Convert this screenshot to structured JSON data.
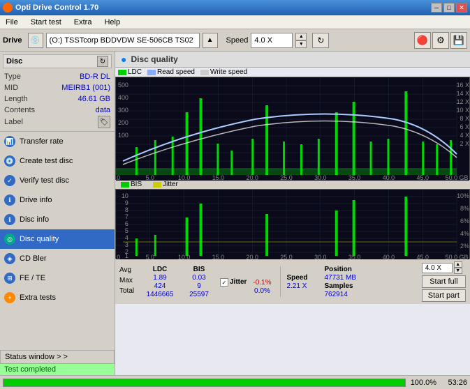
{
  "app": {
    "title": "Opti Drive Control 1.70",
    "icon": "disc-icon"
  },
  "titlebar": {
    "minimize": "─",
    "maximize": "□",
    "close": "✕"
  },
  "menu": {
    "items": [
      "File",
      "Start test",
      "Extra",
      "Help"
    ]
  },
  "drivebar": {
    "drive_label": "Drive",
    "drive_value": "(O:)  TSSTcorp BDDVDW SE-506CB TS02",
    "speed_label": "Speed",
    "speed_value": "4.0 X"
  },
  "disc": {
    "title": "Disc",
    "type_label": "Type",
    "type_value": "BD-R DL",
    "mid_label": "MID",
    "mid_value": "MEIRB1 (001)",
    "length_label": "Length",
    "length_value": "46.61 GB",
    "contents_label": "Contents",
    "contents_value": "data",
    "label_label": "Label"
  },
  "sidebar": {
    "items": [
      {
        "label": "Transfer rate",
        "icon": "chart-icon"
      },
      {
        "label": "Create test disc",
        "icon": "disc-create-icon"
      },
      {
        "label": "Verify test disc",
        "icon": "disc-verify-icon"
      },
      {
        "label": "Drive info",
        "icon": "drive-info-icon"
      },
      {
        "label": "Disc info",
        "icon": "disc-info-icon"
      },
      {
        "label": "Disc quality",
        "icon": "disc-quality-icon",
        "active": true
      },
      {
        "label": "CD Bler",
        "icon": "cd-bler-icon"
      },
      {
        "label": "FE / TE",
        "icon": "fe-te-icon"
      },
      {
        "label": "Extra tests",
        "icon": "extra-tests-icon"
      }
    ],
    "status_window": "Status window > >",
    "test_completed": "Test completed"
  },
  "disc_quality": {
    "title": "Disc quality",
    "legend": {
      "ldc_label": "LDC",
      "ldc_color": "#00cc00",
      "read_speed_label": "Read speed",
      "read_speed_color": "#aaccff",
      "write_speed_label": "Write speed",
      "write_speed_color": "#ffffff",
      "bis_label": "BIS",
      "bis_color": "#00cc00",
      "jitter_label": "Jitter",
      "jitter_color": "#ffff00"
    }
  },
  "stats": {
    "ldc_header": "LDC",
    "bis_header": "BIS",
    "jitter_header": "Jitter",
    "speed_header": "Speed",
    "position_header": "Position",
    "samples_header": "Samples",
    "avg_label": "Avg",
    "max_label": "Max",
    "total_label": "Total",
    "ldc_avg": "1.89",
    "ldc_max": "424",
    "ldc_total": "1446665",
    "bis_avg": "0.03",
    "bis_max": "9",
    "bis_total": "25597",
    "jitter_avg": "-0.1%",
    "jitter_max": "0.0%",
    "speed_val": "2.21 X",
    "position_val": "47731 MB",
    "samples_val": "762914",
    "speed_select": "4.0 X",
    "start_full": "Start full",
    "start_part": "Start part"
  },
  "statusbar": {
    "progress_pct": 100,
    "progress_text": "100.0%",
    "time": "53:26"
  },
  "colors": {
    "bg_dark": "#1a1a2e",
    "grid_line": "#2a2a4a",
    "ldc_bar": "#00cc00",
    "read_speed": "#88aaff",
    "write_speed": "#ffffff",
    "bis_bar": "#00cc00",
    "jitter_line": "#cccc00",
    "active_sidebar": "#316ac5"
  }
}
